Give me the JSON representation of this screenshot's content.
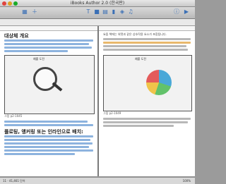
{
  "window": {
    "title": "iBooks Author 2.0 (한국판)"
  },
  "toolbar": {
    "buttons": [
      "보기",
      "페이지 추가",
      "텍스트",
      "도형",
      "표",
      "차트",
      "위젯",
      "미디어",
      "검사기",
      "미리보기"
    ]
  },
  "document": {
    "left_page": {
      "heading_1": "대상체 개요",
      "figure_1_caption": "그림 p2-1045",
      "heading_2": "플로팅, 앵커링 또는 인라인으로 배치:",
      "figure_1_title": "예를 도전"
    },
    "right_page": {
      "intro": "요즘 책에는 위젯과 같은 상호작용 요소가 포함됩니다.",
      "figure_2_title": "예를 도전",
      "figure_2_caption": "그림 p2-1049"
    }
  },
  "statusbar": {
    "page_info": "11 · 41,461 단어",
    "zoom": "100%"
  }
}
